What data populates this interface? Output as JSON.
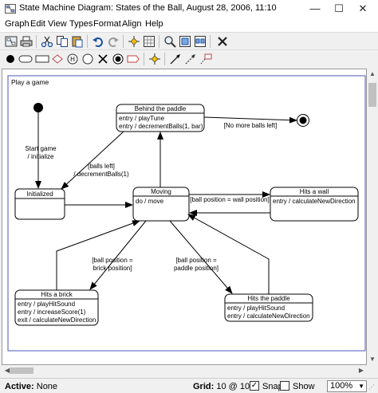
{
  "window": {
    "title": "State Machine Diagram: States of the Ball, August 28, 2006, 11:10",
    "min_glyph": "—",
    "max_glyph": "☐",
    "close_glyph": "✕"
  },
  "menu": [
    "Graph",
    "Edit",
    "View",
    "Types",
    "Format",
    "Align",
    "Help"
  ],
  "toolbar1": [
    "properties-icon",
    "print-icon",
    "cut-icon",
    "copy-icon",
    "paste-icon",
    "undo-icon",
    "redo-icon",
    "snap-icon",
    "grid-icon",
    "zoom-icon",
    "zoom-fit-icon",
    "zoom-page-icon",
    "delete-icon"
  ],
  "toolbar2": [
    "initial-state-icon",
    "state-icon",
    "decision-icon",
    "history-icon",
    "deep-history-icon",
    "junction-icon",
    "terminate-icon",
    "final-state-icon",
    "signal-icon",
    "fork-icon",
    "transition-icon",
    "flow-icon",
    "note-link-icon"
  ],
  "diagram": {
    "frame_label": "Play a game",
    "states": {
      "behind_paddle": {
        "name": "Behind the paddle",
        "actions": [
          "entry / playTune",
          "entry / decrementBalls(1, bar)"
        ]
      },
      "initialized": {
        "name": "Initialized",
        "actions": []
      },
      "moving": {
        "name": "Moving",
        "actions": [
          "do / move"
        ]
      },
      "hits_wall": {
        "name": "Hits a wall",
        "actions": [
          "entry / calculateNewDirection"
        ]
      },
      "hits_brick": {
        "name": "Hits a brick",
        "actions": [
          "entry / playHitSound",
          "entry / increaseScore(1)",
          "exit / calculateNewDirection"
        ]
      },
      "hits_paddle": {
        "name": "Hits the paddle",
        "actions": [
          "entry / playHitSound",
          "entry / calculateNewDirection"
        ]
      }
    },
    "transitions": {
      "start": [
        "Start game",
        "/ initialize"
      ],
      "no_more_balls": "[No more balls left]",
      "balls_left": [
        "[balls left]",
        "/ decrementBalls(1)"
      ],
      "wall": "[ball position = wall position]",
      "brick": [
        "[ball position =",
        "brick position]"
      ],
      "paddle": [
        "[ball position =",
        "paddle position]"
      ]
    }
  },
  "status": {
    "active_label": "Active:",
    "active_value": "None",
    "grid_label": "Grid:",
    "grid_value": "10 @ 10",
    "snap_label": "Snap",
    "snap_checked": true,
    "show_label": "Show",
    "show_checked": false,
    "zoom": "100%"
  }
}
